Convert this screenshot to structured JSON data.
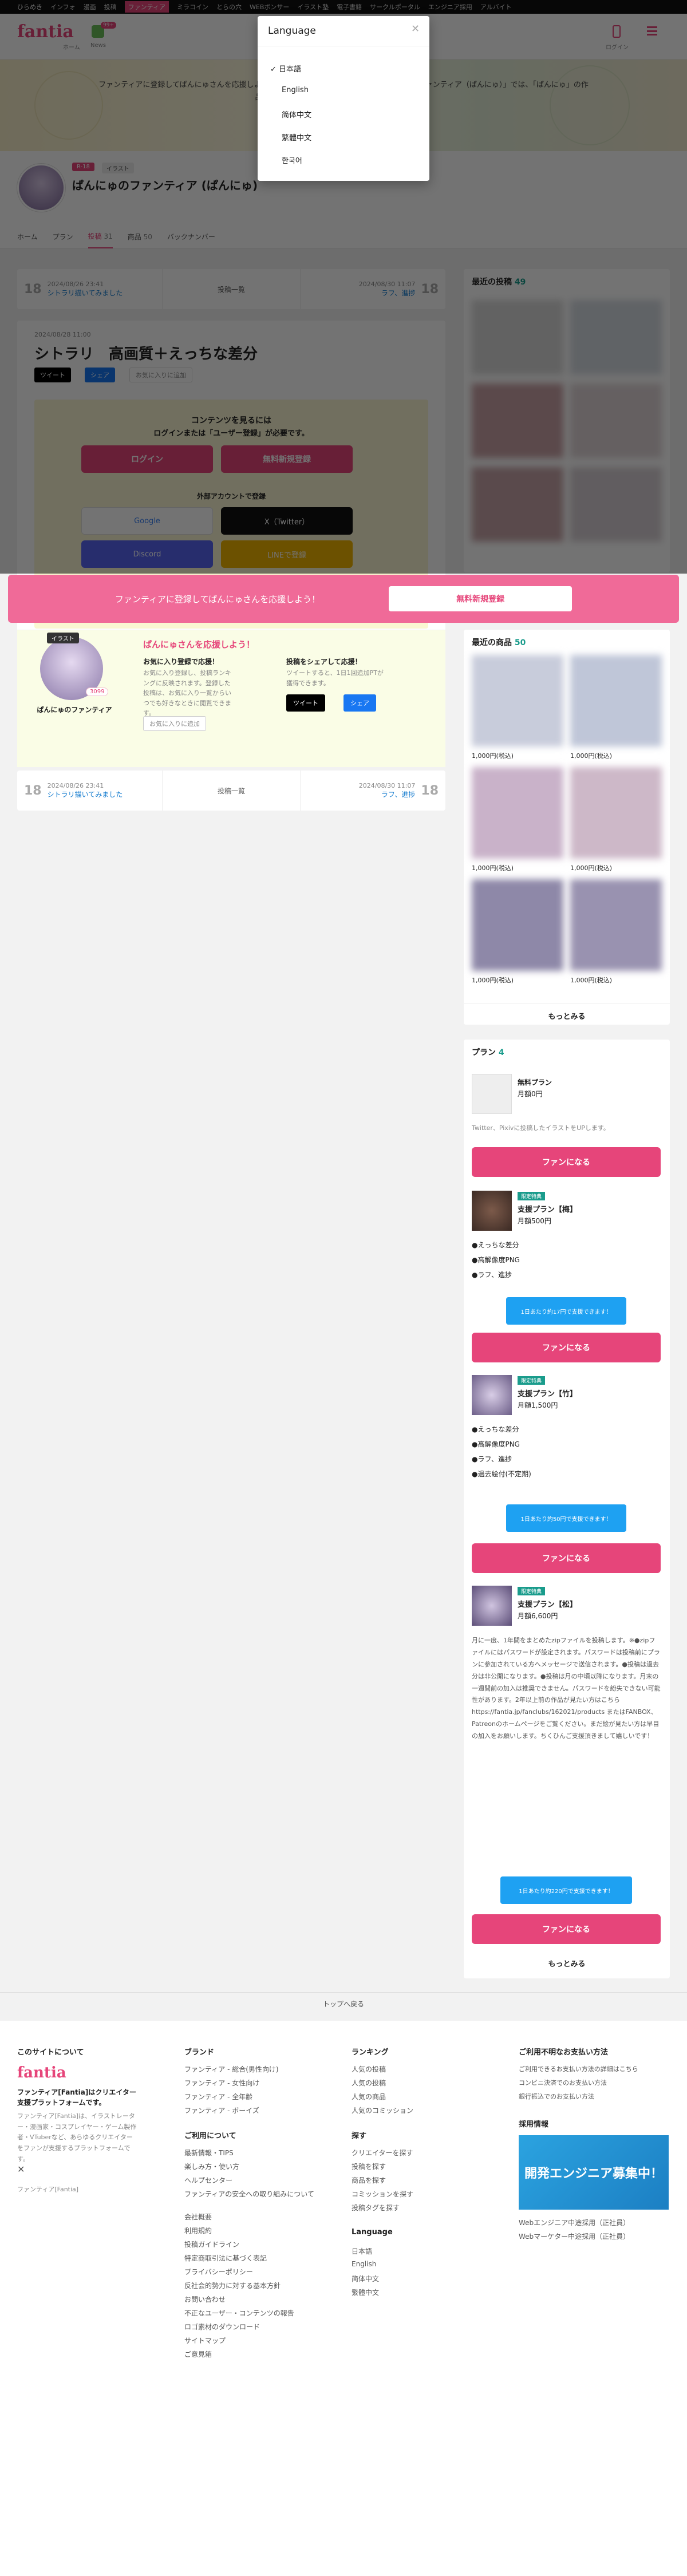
{
  "topnav": {
    "items": [
      "ひらめき",
      "インフォ",
      "漫画",
      "投稿",
      "ファンティア",
      "ミラコイン",
      "とらの穴",
      "WEBボンサー",
      "イラスト塾",
      "電子書籍",
      "サークルポータル",
      "エンジニア採用",
      "アルバイト"
    ],
    "active_index": 4
  },
  "header": {
    "logo": "fantia",
    "home_label": "ホーム",
    "news_label": "News",
    "news_badge": "99+",
    "user_label": "ログイン",
    "icons": [
      "user-icon",
      "menu-icon"
    ]
  },
  "banner": {
    "text": "ファンティアに登録してぱんにゅさんを応援しよう！ぱんにゅさんのファンクラブ「ぱんにゅのファンティア（ぱんにゅ）」では、「ぱんにゅ」の作品をいち早くお届けしています。支援いただけます。"
  },
  "language_modal": {
    "title": "Language",
    "options": [
      "日本語",
      "English",
      "简体中文",
      "繁體中文",
      "한국어"
    ],
    "selected": "日本語"
  },
  "profile": {
    "tags": [
      "R-18",
      "イラスト"
    ],
    "name": "ぱんにゅのファンティア (ぱんにゅ)"
  },
  "tabs": [
    {
      "label": "ホーム"
    },
    {
      "label": "プラン"
    },
    {
      "label": "投稿",
      "count": "31"
    },
    {
      "label": "商品",
      "count": "50"
    },
    {
      "label": "バックナンバー"
    }
  ],
  "post_nav_top": {
    "prev_date": "2024/08/26 23:41",
    "prev_title": "シトラリ描いてみました",
    "list": "投稿一覧",
    "next_date": "2024/08/30 11:07",
    "next_title": "ラフ、進捗",
    "r18": "18"
  },
  "post": {
    "date": "2024/08/28 11:00",
    "title": "シトラリ　高画質＋えっちな差分",
    "tweet": "ツイート",
    "share": "シェア",
    "favorite": "お気に入りに追加"
  },
  "gate": {
    "heading": "コンテンツを見るには",
    "subheading": "ログインまたは「ユーザー登録」が必要です。",
    "login": "ログイン",
    "register": "無料新規登録",
    "external": "外部アカウントで登録",
    "google": "Google",
    "x": "X（Twitter）",
    "discord": "Discord",
    "line": "LINEで登録"
  },
  "support_card": {
    "badge": "イラスト",
    "title": "ぱんにゅさんを応援しよう！",
    "name": "ぱんにゅのファンティア",
    "fan_count": "3099",
    "follow_title": "お気に入り登録で応援！",
    "follow_text": "お気に入り登録し、投稿ランキングに反映されます。登録した投稿は、お気に入り一覧からいつでも好きなときに閲覧できます。",
    "follow_btn": "お気に入りに追加",
    "share_title": "投稿をシェアして応援！",
    "share_text": "ツイートすると、1日1回追加PTが獲得できます。",
    "tweet": "ツイート",
    "share": "シェア"
  },
  "post_nav_bottom": {
    "prev_date": "2024/08/26 23:41",
    "prev_title": "シトラリ描いてみました",
    "list": "投稿一覧",
    "next_date": "2024/08/30 11:07",
    "next_title": "ラフ、進捗",
    "r18": "18"
  },
  "sticky_cta": {
    "text": "ファンティアに登録してぱんにゅさんを応援しよう！",
    "button": "無料新規登録"
  },
  "sidebar": {
    "recent_posts_title": "最近の投稿",
    "recent_posts_count": "49",
    "recent_products_title": "最近の商品",
    "recent_products_count": "50",
    "products": [
      {
        "price": "1,000円(税込)"
      },
      {
        "price": "1,000円(税込)"
      },
      {
        "price": "1,000円(税込)"
      },
      {
        "price": "1,000円(税込)"
      },
      {
        "price": "1,000円(税込)"
      },
      {
        "price": "1,000円(税込)"
      }
    ],
    "more": "もっとみる",
    "plans_title": "プラン",
    "plans_count": "4",
    "plans": [
      {
        "name": "無料プラン",
        "price": "月額0円",
        "desc": "Twitter、Pixivに投稿したイラストをUPします。",
        "button": "ファンになる",
        "features": []
      },
      {
        "badge": "限定特典",
        "name": "支援プラン【梅】",
        "price": "月額500円",
        "features": [
          "●えっちな差分",
          "●高解像度PNG",
          "●ラフ、進捗"
        ],
        "promo": "1日あたり約17円で支援できます！",
        "button": "ファンになる"
      },
      {
        "badge": "限定特典",
        "name": "支援プラン【竹】",
        "price": "月額1,500円",
        "features": [
          "●えっちな差分",
          "●高解像度PNG",
          "●ラフ、進捗",
          "●過去絵付(不定期)"
        ],
        "promo": "1日あたり約50円で支援できます！",
        "button": "ファンになる"
      },
      {
        "badge": "限定特典",
        "name": "支援プラン【松】",
        "price": "月額6,600円",
        "desc": "月に一度、1年間をまとめたzipファイルを投稿します。※●zipファイルにはパスワードが設定されます。パスワードは投稿前にプランに参加されている方へメッセージで送信されます。●投稿は過去分は非公開になります。●投稿は月の中頃以降になります。月末の一週間前の加入は推奨できません。パスワードを紛失できない可能性があります。2年以上前の作品が見たい方はこちら https://fantia.jp/fanclubs/162021/products またはFANBOX、Patreonのホームページをご覧ください。まだ絵が見たい方は早目の加入をお願いします。ちくひんご支援頂きまして嬉しいです！",
        "promo": "1日あたり約220円で支援できます！",
        "button": "ファンになる"
      }
    ],
    "plans_more": "もっとみる"
  },
  "back_to_top": "トップへ戻る",
  "footer": {
    "about_title": "このサイトについて",
    "about_logo": "fantia",
    "about_heading": "ファンティア[Fantia]はクリエイター支援プラットフォームです。",
    "about_text": "ファンティア[Fantia]は、イラストレーター・漫画家・コスプレイヤー・ゲーム製作者・VTuberなど、あらゆるクリエイターをファンが支援するプラットフォームです。",
    "about_link": "ファンティア[Fantia]",
    "brand_title": "ブランド",
    "brand_links": [
      "ファンティア - 総合(男性向け)",
      "ファンティア - 女性向け",
      "ファンティア - 全年齢",
      "ファンティア - ボーイズ"
    ],
    "usage_title": "ご利用について",
    "usage_links": [
      "最新情報・TIPS",
      "楽しみ方・使い方",
      "ヘルプセンター",
      "ファンティアの安全への取り組みについて",
      "会社概要",
      "利用規約",
      "投稿ガイドライン",
      "特定商取引法に基づく表記",
      "プライバシーポリシー",
      "反社会的勢力に対する基本方針",
      "お問い合わせ",
      "不正なユーザー・コンテンツの報告",
      "ロゴ素材のダウンロード",
      "サイトマップ",
      "ご意見箱"
    ],
    "ranking_title": "ランキング",
    "ranking_links": [
      "人気の投稿",
      "人気の投稿",
      "人気の商品",
      "人気のコミッション"
    ],
    "search_title": "探す",
    "search_links": [
      "クリエイターを探す",
      "投稿を探す",
      "商品を探す",
      "コミッションを探す",
      "投稿タグを探す"
    ],
    "lang_title": "Language",
    "lang_links": [
      "日本語",
      "English",
      "简体中文",
      "繁體中文"
    ],
    "safety_title": "ご利用不明なお支払い方法",
    "safety_links": [
      "ご利用できるお支払い方法の詳細はこちら",
      "コンビニ決済でのお支払い方法",
      "銀行振込でのお支払い方法"
    ],
    "recruit_title": "採用情報",
    "recruit_banner": "開発エンジニア募集中！",
    "recruit_links": [
      "Webエンジニア中途採用（正社員）",
      "Webマーケター中途採用（正社員）"
    ]
  },
  "colors": {
    "accent": "#e6457a",
    "overlay": "rgba(0,0,0,0.55)",
    "promo": "#1ea1f2"
  }
}
